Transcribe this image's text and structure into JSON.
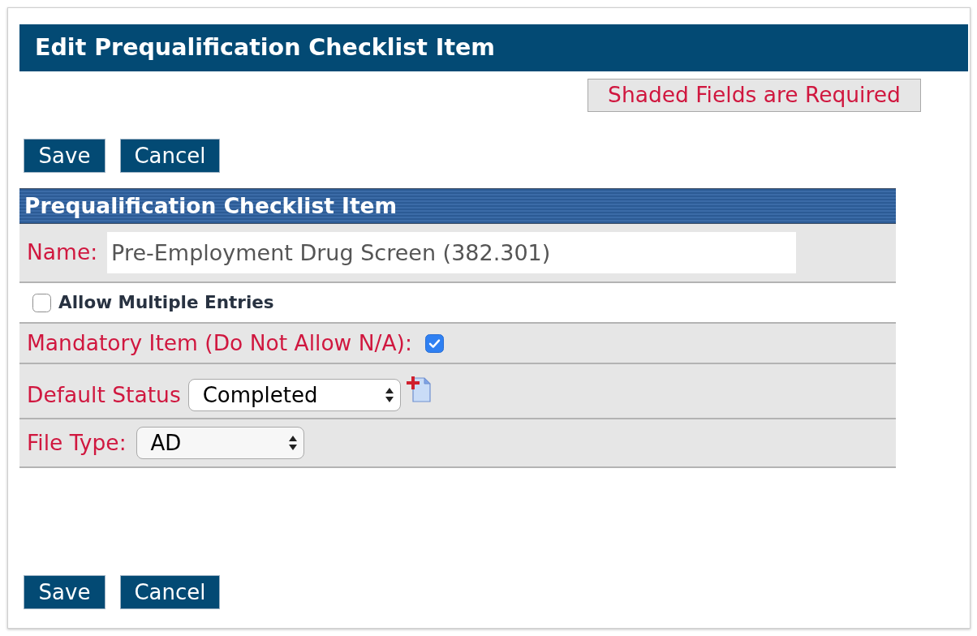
{
  "page": {
    "title": "Edit Prequalification Checklist Item"
  },
  "required_notice": "Shaded Fields are Required",
  "top_buttons": [
    {
      "label": "Save"
    },
    {
      "label": "Cancel"
    }
  ],
  "section": {
    "title": "Prequalification Checklist Item",
    "fields": [
      {
        "kind": "text",
        "label": "Name:",
        "value": "Pre-Employment Drug Screen (382.301)",
        "required": true
      },
      {
        "kind": "checkbox",
        "label": "Allow Multiple Entries",
        "checked": false,
        "required": false
      },
      {
        "kind": "flag",
        "label": "Mandatory Item (Do Not Allow N/A):",
        "checked": true,
        "required": true
      },
      {
        "kind": "lookup",
        "label": "Default Status",
        "value": "Completed",
        "required": true
      },
      {
        "kind": "select",
        "label": "File Type:",
        "value": "AD",
        "required": true
      }
    ]
  },
  "bottom_buttons": [
    {
      "label": "Save"
    },
    {
      "label": "Cancel"
    }
  ]
}
